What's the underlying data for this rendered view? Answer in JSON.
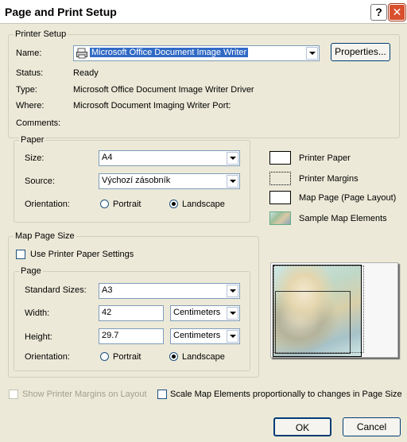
{
  "window": {
    "title": "Page and Print Setup",
    "help_label": "?",
    "close_label": "✕"
  },
  "printer_setup": {
    "legend": "Printer Setup",
    "name_label": "Name:",
    "name_value": "Microsoft Office Document Image Writer",
    "properties_label": "Properties...",
    "status_label": "Status:",
    "status_value": "Ready",
    "type_label": "Type:",
    "type_value": "Microsoft Office Document Image Writer Driver",
    "where_label": "Where:",
    "where_value": "Microsoft Document Imaging Writer Port:",
    "comments_label": "Comments:"
  },
  "paper": {
    "legend": "Paper",
    "size_label": "Size:",
    "size_value": "A4",
    "source_label": "Source:",
    "source_value": "Výchozí zásobník",
    "orientation_label": "Orientation:",
    "portrait_label": "Portrait",
    "landscape_label": "Landscape",
    "orientation_selected": "Landscape"
  },
  "legend_key": {
    "items": [
      {
        "label": "Printer Paper",
        "icon": "printer-paper-swatch"
      },
      {
        "label": "Printer Margins",
        "icon": "printer-margins-swatch"
      },
      {
        "label": "Map Page (Page Layout)",
        "icon": "map-page-swatch"
      },
      {
        "label": "Sample Map Elements",
        "icon": "sample-map-elements-swatch"
      }
    ]
  },
  "map_page_size": {
    "legend": "Map Page Size",
    "use_printer_label": "Use Printer Paper Settings",
    "use_printer_checked": false,
    "page": {
      "legend": "Page",
      "standard_sizes_label": "Standard Sizes:",
      "standard_sizes_value": "A3",
      "width_label": "Width:",
      "width_value": "42",
      "width_unit": "Centimeters",
      "height_label": "Height:",
      "height_value": "29.7",
      "height_unit": "Centimeters",
      "orientation_label": "Orientation:",
      "portrait_label": "Portrait",
      "landscape_label": "Landscape",
      "orientation_selected": "Landscape"
    }
  },
  "footer": {
    "show_margins_label": "Show Printer Margins on Layout",
    "show_margins_checked": false,
    "show_margins_enabled": false,
    "scale_label": "Scale Map Elements proportionally to changes in Page Size",
    "scale_checked": false,
    "ok_label": "OK",
    "cancel_label": "Cancel"
  }
}
